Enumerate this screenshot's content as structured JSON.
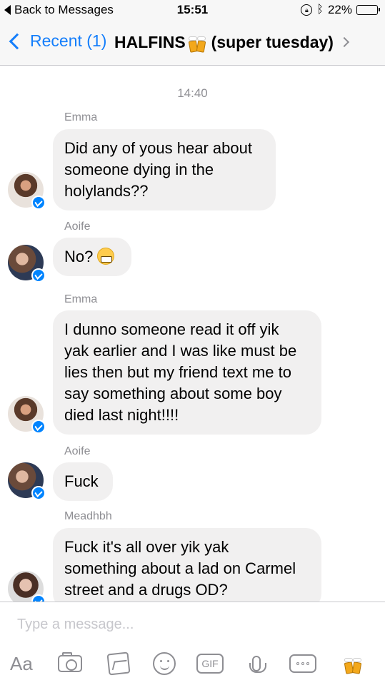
{
  "status_bar": {
    "back_label": "Back to Messages",
    "time": "15:51",
    "battery_text": "22%",
    "battery_level": 0.22,
    "icons": [
      "lock-rotation-icon",
      "bluetooth-icon",
      "battery-icon"
    ]
  },
  "nav": {
    "back_label": "Recent (1)",
    "title_name": "HALFINS",
    "title_emoji": "beer-mugs-emoji",
    "title_suffix": "(super tuesday)"
  },
  "thread": {
    "timestamp": "14:40",
    "messages": [
      {
        "sender": "Emma",
        "text": "Did any of yous hear about someone dying in the holylands??",
        "lines": [
          "Did any of yous hear about",
          "someone dying in the",
          "holylands??"
        ]
      },
      {
        "sender": "Aoife",
        "text": "No?",
        "emoji": "grimacing-face-emoji"
      },
      {
        "sender": "Emma",
        "lines": [
          "I dunno someone read it off yik",
          "yak earlier and I was like must be",
          "lies then but my friend text me to",
          "say something about some boy",
          "died last night!!!!"
        ]
      },
      {
        "sender": "Aoife",
        "text": "Fuck"
      },
      {
        "sender": "Meadhbh",
        "lines": [
          "Fuck it's all over yik yak",
          "something about a lad on Carmel",
          "street and a drugs OD?"
        ]
      }
    ]
  },
  "composer": {
    "placeholder": "Type a message...",
    "aa_label": "Aa",
    "gif_label": "GIF",
    "tools": [
      "text-format-icon",
      "camera-icon",
      "gallery-icon",
      "emoji-icon",
      "gif-icon",
      "microphone-icon",
      "more-icon",
      "beer-mugs-emoji"
    ]
  },
  "colors": {
    "accent": "#147efb",
    "bubble": "#f1f0f0",
    "badge": "#0084ff",
    "meta_text": "#8e8e93"
  }
}
